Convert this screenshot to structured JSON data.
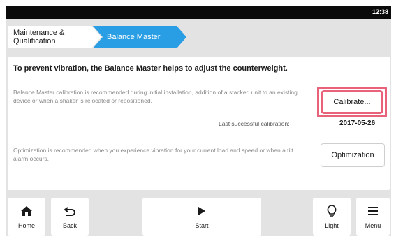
{
  "status_bar": {
    "time": "12:38"
  },
  "breadcrumb": {
    "parent": "Maintenance & Qualification",
    "active": "Balance Master",
    "active_color": "#2a9ee4"
  },
  "panel": {
    "headline": "To prevent vibration, the Balance Master helps to adjust the counterweight.",
    "calibration_description": "Balance Master calibration is recommended during initial installation, addition of a stacked unit to an existing device or when a shaker is relocated or repositioned.",
    "calibrate_button": "Calibrate...",
    "calibrate_highlight_color": "#e8627a",
    "last_calibration_label": "Last successful calibration:",
    "last_calibration_value": "2017-05-26",
    "optimization_description": "Optimization is recommended when you experience vibration for your current load and speed or when a tilt alarm occurs.",
    "optimization_button": "Optimization"
  },
  "bottom_bar": {
    "home": {
      "label": "Home",
      "icon": "home-icon"
    },
    "back": {
      "label": "Back",
      "icon": "back-arrow-icon"
    },
    "start": {
      "label": "Start",
      "icon": "play-icon"
    },
    "light": {
      "label": "Light",
      "icon": "lightbulb-icon"
    },
    "menu": {
      "label": "Menu",
      "icon": "hamburger-menu-icon"
    }
  }
}
